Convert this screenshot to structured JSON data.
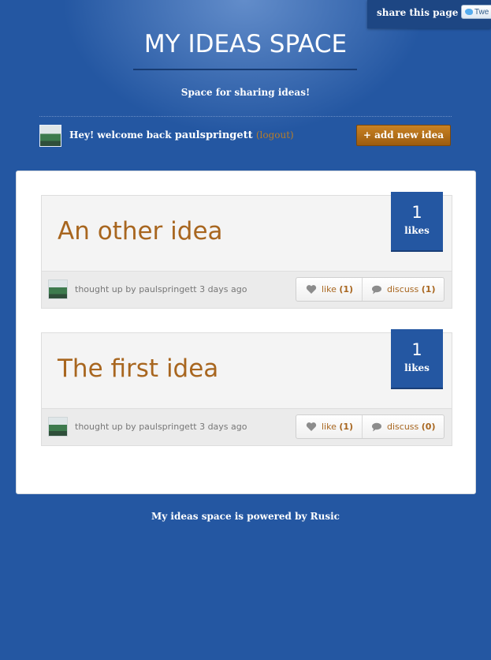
{
  "share": {
    "label": "share this page",
    "tweet_label": "Twe"
  },
  "header": {
    "title": "MY IDEAS SPACE",
    "tagline": "Space for sharing ideas!"
  },
  "user": {
    "greeting": "Hey! welcome back",
    "username": "paulspringett",
    "logout": "(logout)"
  },
  "toolbar": {
    "add_label": "+ add new idea"
  },
  "ideas": [
    {
      "title": "An other idea",
      "likes_count": "1",
      "likes_label": "likes",
      "byline": "thought up by paulspringett 3 days ago",
      "like_label": "like",
      "like_count": "(1)",
      "discuss_label": "discuss",
      "discuss_count": "(1)"
    },
    {
      "title": "The first idea",
      "likes_count": "1",
      "likes_label": "likes",
      "byline": "thought up by paulspringett 3 days ago",
      "like_label": "like",
      "like_count": "(1)",
      "discuss_label": "discuss",
      "discuss_count": "(0)"
    }
  ],
  "footer": {
    "text": "My ideas space is powered by Rusic"
  },
  "colors": {
    "background": "#2457a2",
    "accent": "#a8661f",
    "button": "#b06f1b",
    "likes_box": "#2457a2"
  }
}
